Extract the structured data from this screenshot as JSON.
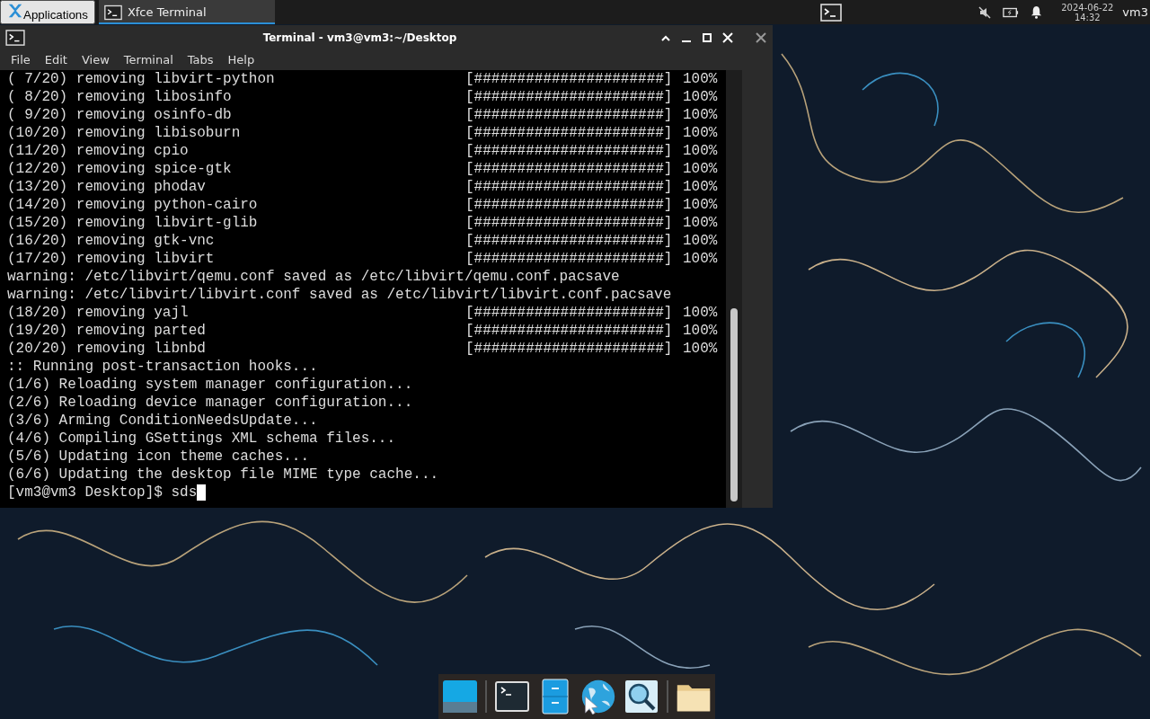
{
  "panel": {
    "menu_label": "Applications",
    "tasks": [
      {
        "label": "Xfce Terminal",
        "selected": true
      }
    ],
    "clock_date": "2024-06-22",
    "clock_time": "14:32",
    "user": "vm3"
  },
  "window": {
    "title": "Terminal - vm3@vm3:~/Desktop",
    "menu": [
      "File",
      "Edit",
      "View",
      "Terminal",
      "Tabs",
      "Help"
    ]
  },
  "terminal": {
    "lines": [
      {
        "kind": "progress",
        "label": "( 7/20) removing libvirt-python",
        "bar": "[######################]",
        "percent": "100%"
      },
      {
        "kind": "progress",
        "label": "( 8/20) removing libosinfo",
        "bar": "[######################]",
        "percent": "100%"
      },
      {
        "kind": "progress",
        "label": "( 9/20) removing osinfo-db",
        "bar": "[######################]",
        "percent": "100%"
      },
      {
        "kind": "progress",
        "label": "(10/20) removing libisoburn",
        "bar": "[######################]",
        "percent": "100%"
      },
      {
        "kind": "progress",
        "label": "(11/20) removing cpio",
        "bar": "[######################]",
        "percent": "100%"
      },
      {
        "kind": "progress",
        "label": "(12/20) removing spice-gtk",
        "bar": "[######################]",
        "percent": "100%"
      },
      {
        "kind": "progress",
        "label": "(13/20) removing phodav",
        "bar": "[######################]",
        "percent": "100%"
      },
      {
        "kind": "progress",
        "label": "(14/20) removing python-cairo",
        "bar": "[######################]",
        "percent": "100%"
      },
      {
        "kind": "progress",
        "label": "(15/20) removing libvirt-glib",
        "bar": "[######################]",
        "percent": "100%"
      },
      {
        "kind": "progress",
        "label": "(16/20) removing gtk-vnc",
        "bar": "[######################]",
        "percent": "100%"
      },
      {
        "kind": "progress",
        "label": "(17/20) removing libvirt",
        "bar": "[######################]",
        "percent": "100%"
      },
      {
        "kind": "text",
        "text": "warning: /etc/libvirt/qemu.conf saved as /etc/libvirt/qemu.conf.pacsave"
      },
      {
        "kind": "text",
        "text": "warning: /etc/libvirt/libvirt.conf saved as /etc/libvirt/libvirt.conf.pacsave"
      },
      {
        "kind": "progress",
        "label": "(18/20) removing yajl",
        "bar": "[######################]",
        "percent": "100%"
      },
      {
        "kind": "progress",
        "label": "(19/20) removing parted",
        "bar": "[######################]",
        "percent": "100%"
      },
      {
        "kind": "progress",
        "label": "(20/20) removing libnbd",
        "bar": "[######################]",
        "percent": "100%"
      },
      {
        "kind": "text",
        "text": ":: Running post-transaction hooks..."
      },
      {
        "kind": "text",
        "text": "(1/6) Reloading system manager configuration..."
      },
      {
        "kind": "text",
        "text": "(2/6) Reloading device manager configuration..."
      },
      {
        "kind": "text",
        "text": "(3/6) Arming ConditionNeedsUpdate..."
      },
      {
        "kind": "text",
        "text": "(4/6) Compiling GSettings XML schema files..."
      },
      {
        "kind": "text",
        "text": "(5/6) Updating icon theme caches..."
      },
      {
        "kind": "text",
        "text": "(6/6) Updating the desktop file MIME type cache..."
      }
    ],
    "prompt": "[vm3@vm3 Desktop]$ sds"
  }
}
